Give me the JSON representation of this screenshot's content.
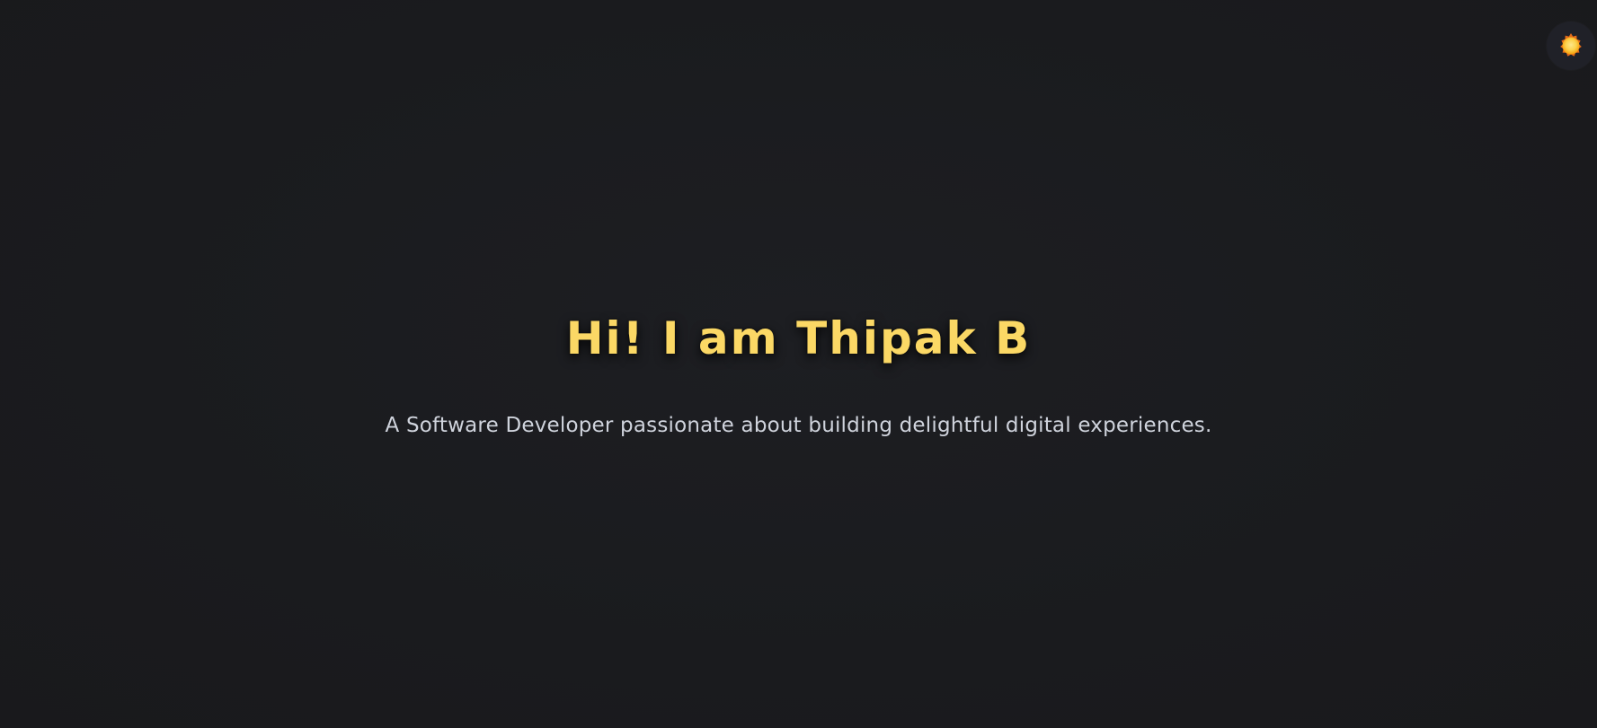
{
  "theme_toggle": {
    "icon": "sun-icon",
    "colors": {
      "sun_outer": "#f5a524",
      "sun_inner": "#fcd34d",
      "button_bg": "#202128"
    }
  },
  "hero": {
    "title": "Hi! I am Thipak B",
    "subtitle": "A Software Developer passionate about building delightful digital experiences."
  },
  "colors": {
    "background": "#1b1c1f",
    "title": "#fbd865",
    "subtitle": "#cfd3dc"
  }
}
